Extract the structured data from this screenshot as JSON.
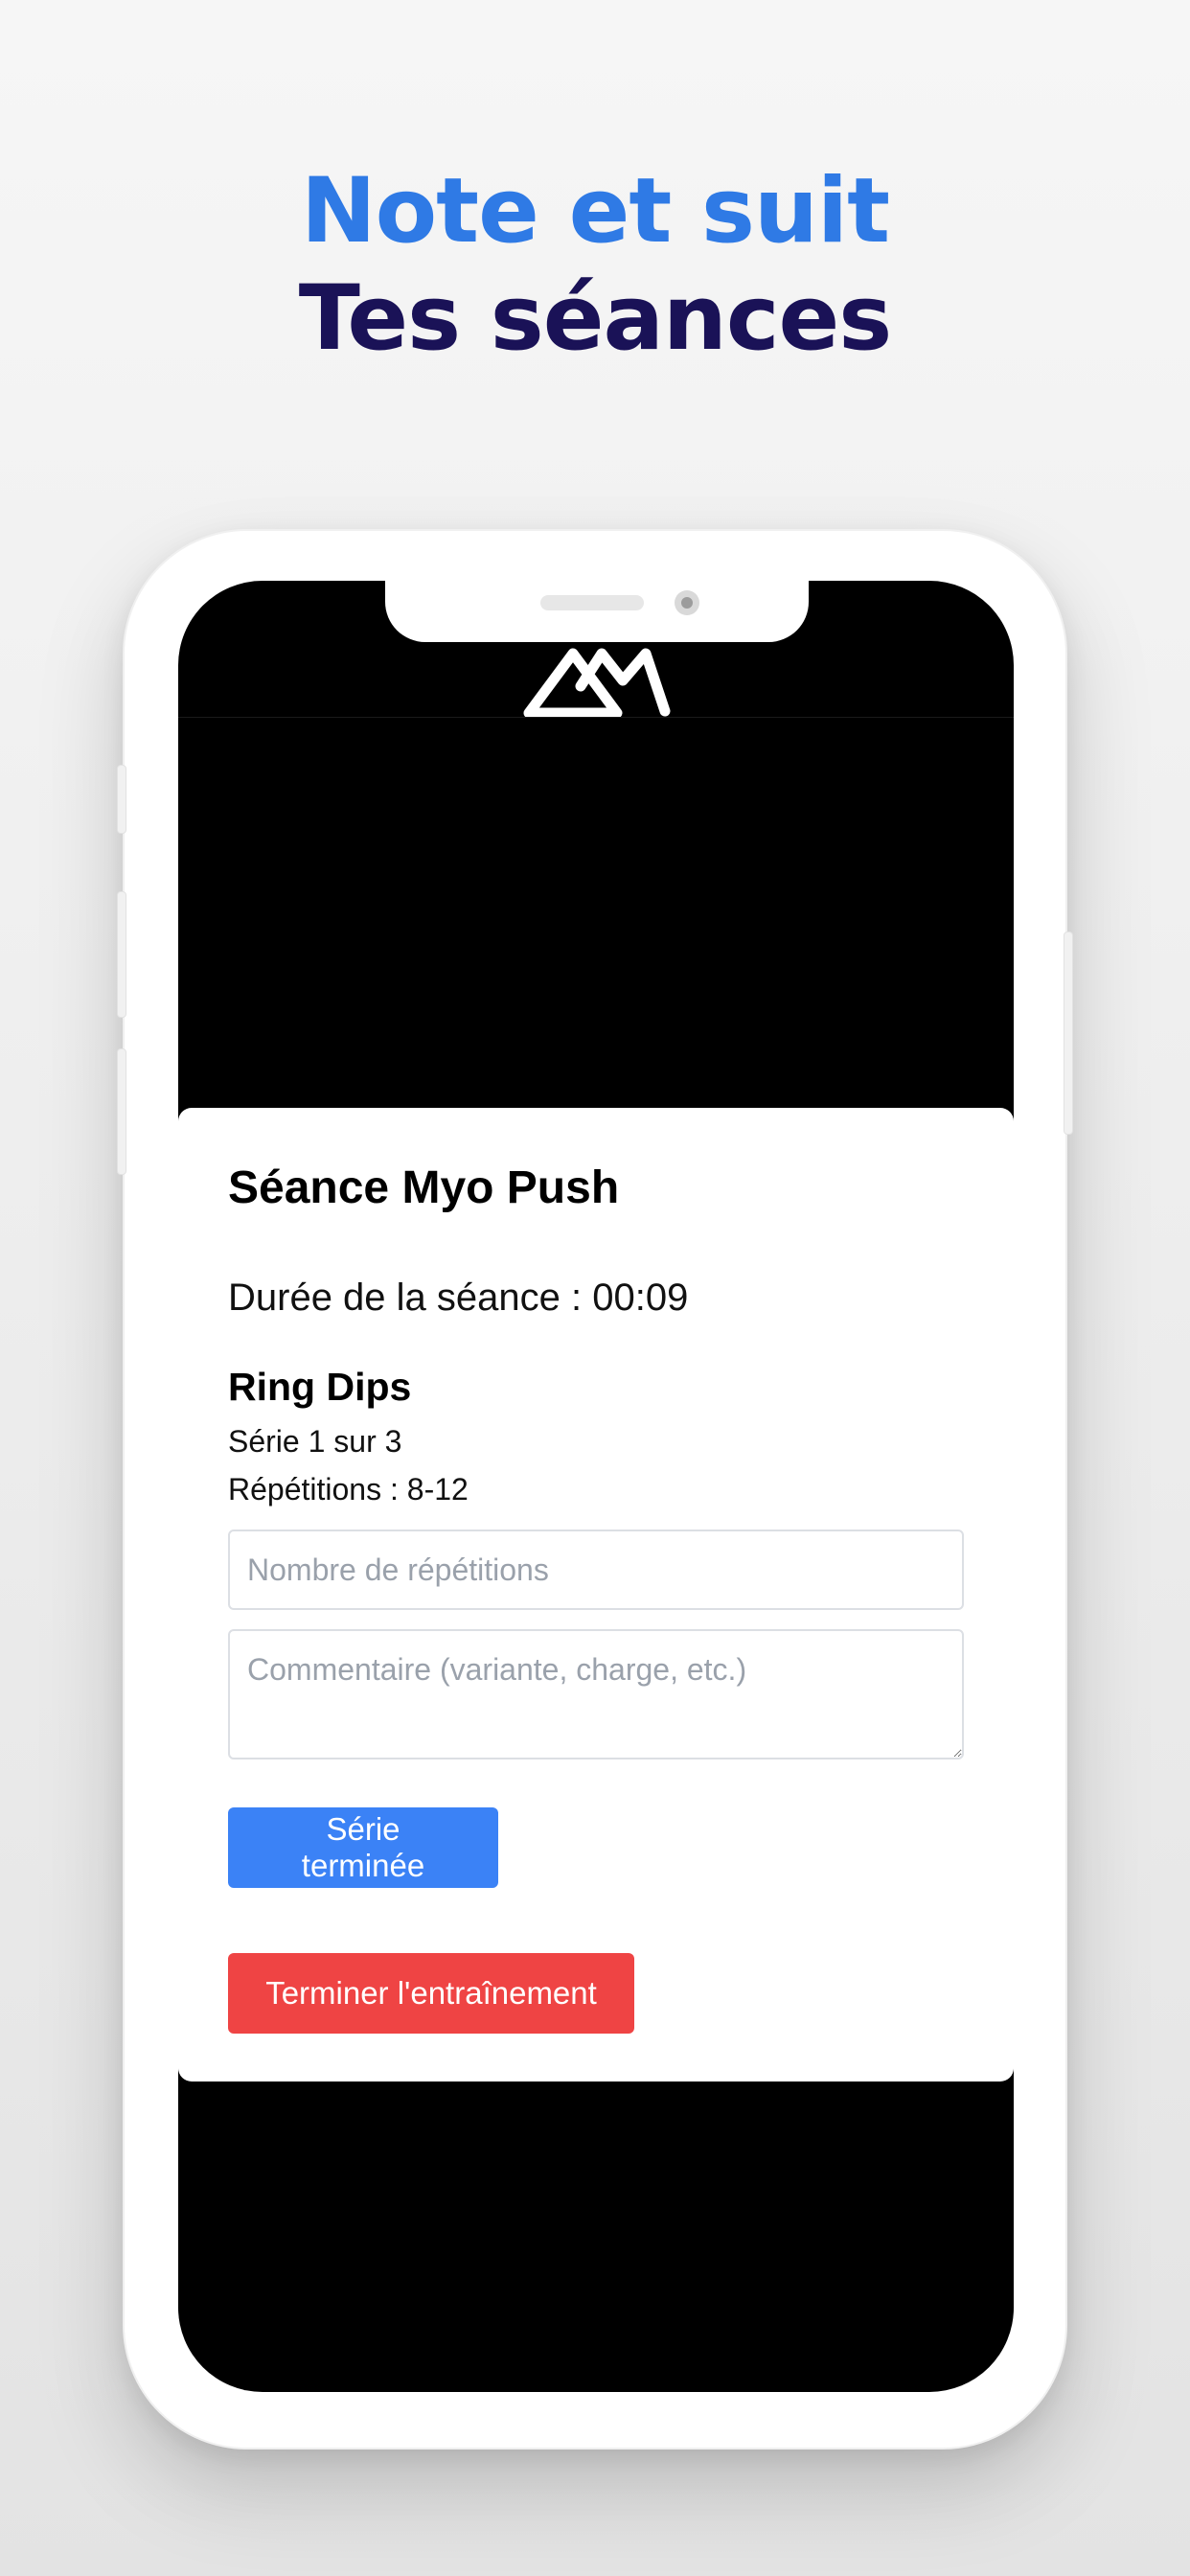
{
  "headline": {
    "line1": "Note et suit",
    "line2": "Tes séances"
  },
  "colors": {
    "headline_accent": "#2f7ae5",
    "headline_dark": "#1a1257",
    "primary_button": "#3b82f6",
    "danger_button": "#ef4444"
  },
  "app": {
    "logo_icon": "app-logo-icon"
  },
  "session": {
    "title": "Séance Myo Push",
    "duration_label": "Durée de la séance : ",
    "duration_value": "00:09"
  },
  "exercise": {
    "name": "Ring Dips",
    "series_text": "Série 1 sur 3",
    "reps_text": "Répétitions : 8-12"
  },
  "form": {
    "reps_placeholder": "Nombre de répétitions",
    "reps_value": "",
    "comment_placeholder": "Commentaire (variante, charge, etc.)",
    "comment_value": ""
  },
  "actions": {
    "series_done_label": "Série terminée",
    "end_workout_label": "Terminer l'entraînement"
  }
}
